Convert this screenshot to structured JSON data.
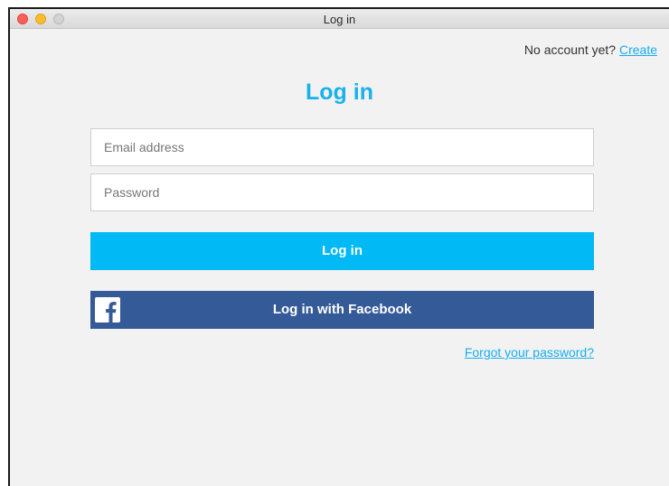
{
  "window": {
    "title": "Log in"
  },
  "account": {
    "prompt": "No account yet?",
    "create_link": "Create"
  },
  "form": {
    "heading": "Log in",
    "email_placeholder": "Email address",
    "password_placeholder": "Password",
    "login_button": "Log in",
    "facebook_button": "Log in with Facebook",
    "forgot_link": "Forgot your password?"
  },
  "icons": {
    "facebook": "facebook-icon"
  },
  "colors": {
    "accent": "#1ab0ee",
    "login_button": "#00b9f5",
    "facebook_button": "#355a98",
    "link": "#16aef0"
  }
}
